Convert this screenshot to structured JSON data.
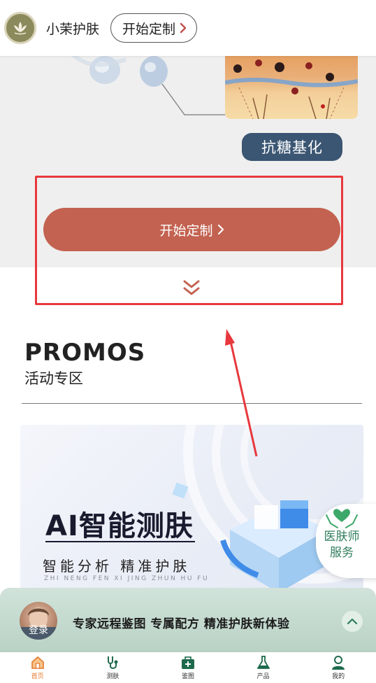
{
  "header": {
    "brand": "小茉护肤",
    "customize_label": "开始定制",
    "chevron": "›"
  },
  "hero": {
    "tag": "抗糖基化",
    "cta_label": "开始定制",
    "cta_chevron": "›"
  },
  "promos": {
    "title": "PROMOS",
    "subtitle": "活动专区",
    "banner": {
      "title": "AI智能测肤",
      "subtitle": "智能分析 精准护肤",
      "pinyin": "ZHI NENG FEN XI  JING ZHUN HU FU"
    }
  },
  "dermatologist": {
    "label": "医肤师服务"
  },
  "promo_bar": {
    "login": "登录",
    "text": "专家远程鉴图 专属配方 精准护肤新体验"
  },
  "tabs": [
    {
      "label": "首页",
      "icon": "home-icon",
      "active": true
    },
    {
      "label": "测肤",
      "icon": "stethoscope-icon",
      "active": false
    },
    {
      "label": "鉴图",
      "icon": "medkit-icon",
      "active": false
    },
    {
      "label": "产品",
      "icon": "flask-icon",
      "active": false
    },
    {
      "label": "我的",
      "icon": "user-icon",
      "active": false
    }
  ],
  "colors": {
    "accent": "#c36250",
    "highlight": "#e8383d",
    "tag_bg": "#3b5673",
    "green": "#2f7d5c",
    "tab_active": "#e67a2e"
  }
}
